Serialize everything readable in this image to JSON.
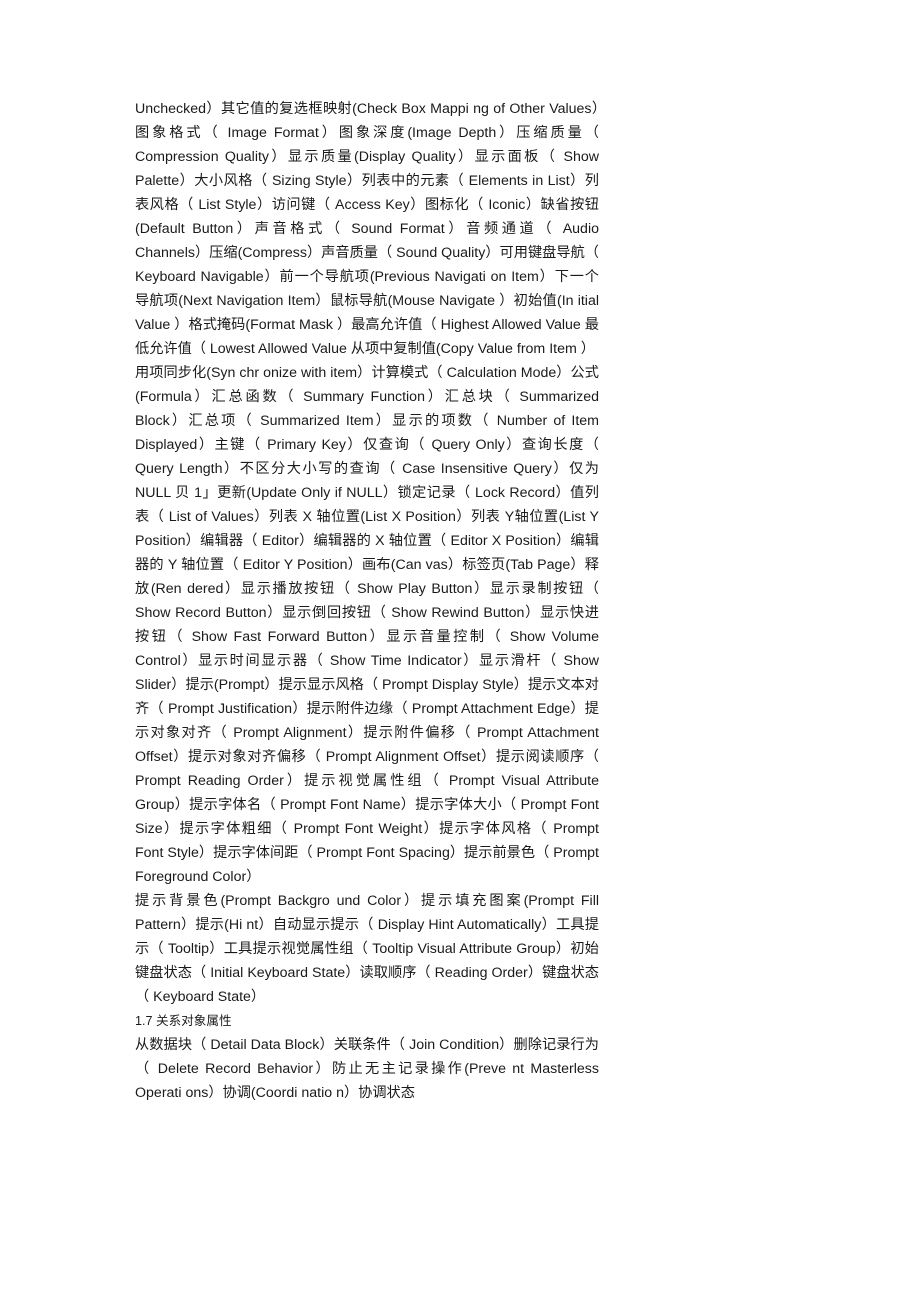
{
  "document": {
    "page_background": "#ffffff",
    "text_color": "#1a1a1a",
    "blocks": [
      {
        "id": "item-properties-continued",
        "type": "paragraph",
        "text": "Unchecked）其它值的复选框映射(Check Box Mappi ng of Other Values）图象格式（ Image Format）图象深度(Image Depth）压缩质量（ Compression Quality）显示质量(Display Quality）显示面板（ Show Palette）大小风格（ Sizing Style）列表中的元素（ Elements in List）列表风格（ List Style）访问键（ Access Key）图标化（ Iconic）缺省按钮(Default Button）声音格式（ Sound Format）音频通道（ Audio Channels）压缩(Compress）声音质量（ Sound Quality）可用键盘导航（ Keyboard Navigable）前一个导航项(Previous Navigati on Item）下一个导航项(Next Navigation Item）鼠标导航(Mouse Navigate ）初始值(In itial Value ）格式掩码(Format Mask ）最高允许值（ Highest Allowed Value 最低允许值（ Lowest Allowed Value 从项中复制值(Copy Value from Item ）"
      },
      {
        "id": "calculation-query-properties",
        "type": "paragraph",
        "text": "用项同步化(Syn chr onize with item）计算模式（ Calculation Mode）公式(Formula）汇总函数（ Summary Function）汇总块（ Summarized Block）汇总项（ Summarized Item）显示的项数（ Number of Item Displayed）主键（ Primary Key）仅查询（ Query Only）查询长度（ Query Length）不区分大小写的查询（ Case Insensitive Query）仅为 NULL 贝 1」更新(Update Only if NULL）锁定记录（ Lock Record）值列表（ List of Values）列表 X 轴位置(List X Position）列表 Y轴位置(List Y Position）编辑器（ Editor）编辑器的 X 轴位置（ Editor X Position）编辑器的 Y 轴位置（ Editor Y Position）画布(Can vas）标签页(Tab Page）释放(Ren dered）显示播放按钮（ Show Play Button）显示录制按钮（ Show Record Button）显示倒回按钮（ Show Rewind Button）显示快进按钮（ Show Fast Forward Button）显示音量控制（ Show Volume Control）显示时间显示器（ Show Time Indicator）显示滑杆（ Show Slider）提示(Prompt）提示显示风格（ Prompt Display Style）提示文本对齐（ Prompt Justification）提示附件边缘（ Prompt Attachment Edge）提示对象对齐（ Prompt Alignment）提示附件偏移（ Prompt Attachment Offset）提示对象对齐偏移（ Prompt Alignment Offset）提示阅读顺序（ Prompt Reading Order）提示视觉属性组（ Prompt Visual Attribute Group）提示字体名（ Prompt Font Name）提示字体大小（ Prompt Font Size）提示字体粗细（ Prompt Font Weight）提示字体风格（ Prompt Font Style）提示字体间距（ Prompt Font Spacing）提示前景色（ Prompt Foreground Color）"
      },
      {
        "id": "prompt-hint-keyboard-properties",
        "type": "paragraph",
        "text": "提示背景色(Prompt Backgro und Color）提示填充图案(Prompt Fill Pattern）提示(Hi nt）自动显示提示（ Display Hint Automatically）工具提示（ Tooltip）工具提示视觉属性组（ Tooltip Visual Attribute Group）初始键盘状态（ Initial Keyboard State）读取顺序（ Reading Order）键盘状态（ Keyboard State）"
      },
      {
        "id": "section-1-7-heading",
        "type": "heading",
        "text": "1.7 关系对象属性"
      },
      {
        "id": "relation-object-properties",
        "type": "paragraph",
        "text": "从数据块（ Detail Data Block）关联条件（ Join Condition）删除记录行为（ Delete Record Behavior）防止无主记录操作(Preve nt Masterless Operati ons）协调(Coordi natio n）协调状态"
      }
    ]
  }
}
